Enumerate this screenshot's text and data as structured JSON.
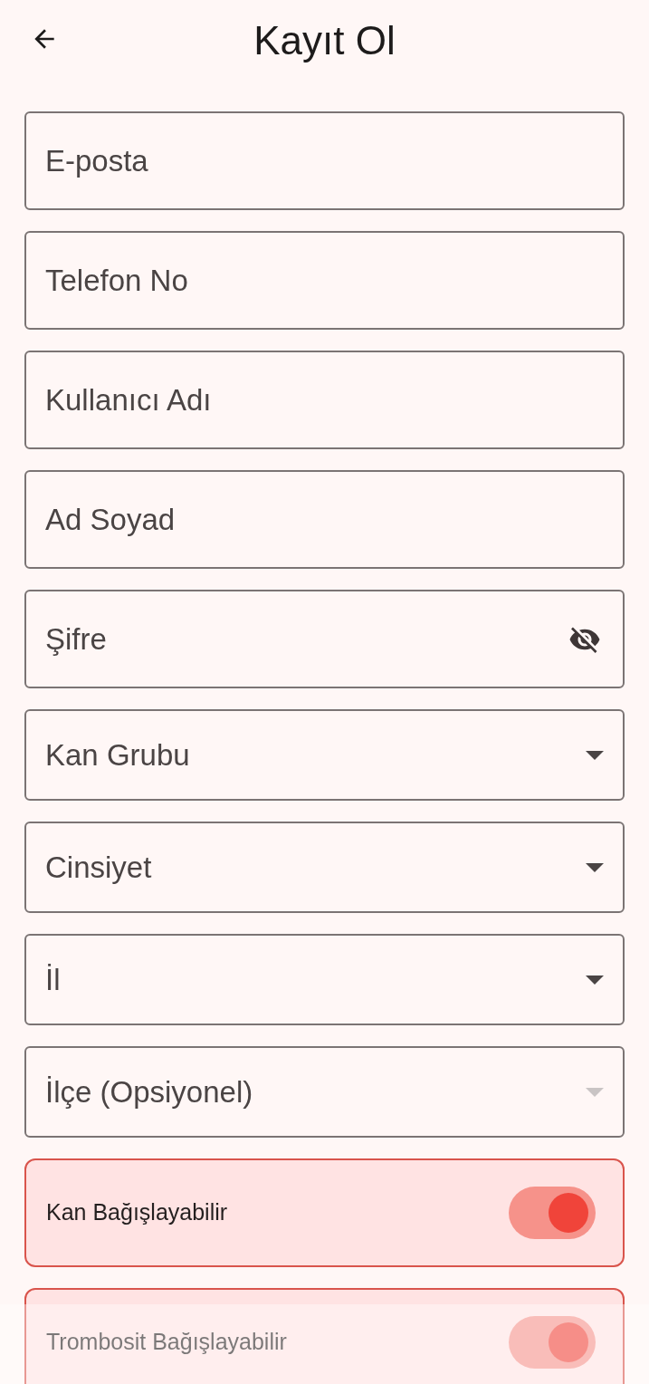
{
  "header": {
    "title": "Kayıt Ol"
  },
  "fields": [
    {
      "kind": "text",
      "placeholder": "E-posta"
    },
    {
      "kind": "text",
      "placeholder": "Telefon No"
    },
    {
      "kind": "text",
      "placeholder": "Kullanıcı Adı"
    },
    {
      "kind": "text",
      "placeholder": "Ad Soyad"
    },
    {
      "kind": "password",
      "placeholder": "Şifre"
    },
    {
      "kind": "dropdown",
      "placeholder": "Kan Grubu",
      "disabled": false
    },
    {
      "kind": "dropdown",
      "placeholder": "Cinsiyet",
      "disabled": false
    },
    {
      "kind": "dropdown",
      "placeholder": "İl",
      "disabled": false
    },
    {
      "kind": "dropdown",
      "placeholder": "İlçe (Opsiyonel)",
      "disabled": true
    }
  ],
  "toggles": [
    {
      "label": "Kan Bağışlayabilir",
      "on": true
    },
    {
      "label": "Trombosit Bağışlayabilir",
      "on": true
    }
  ]
}
